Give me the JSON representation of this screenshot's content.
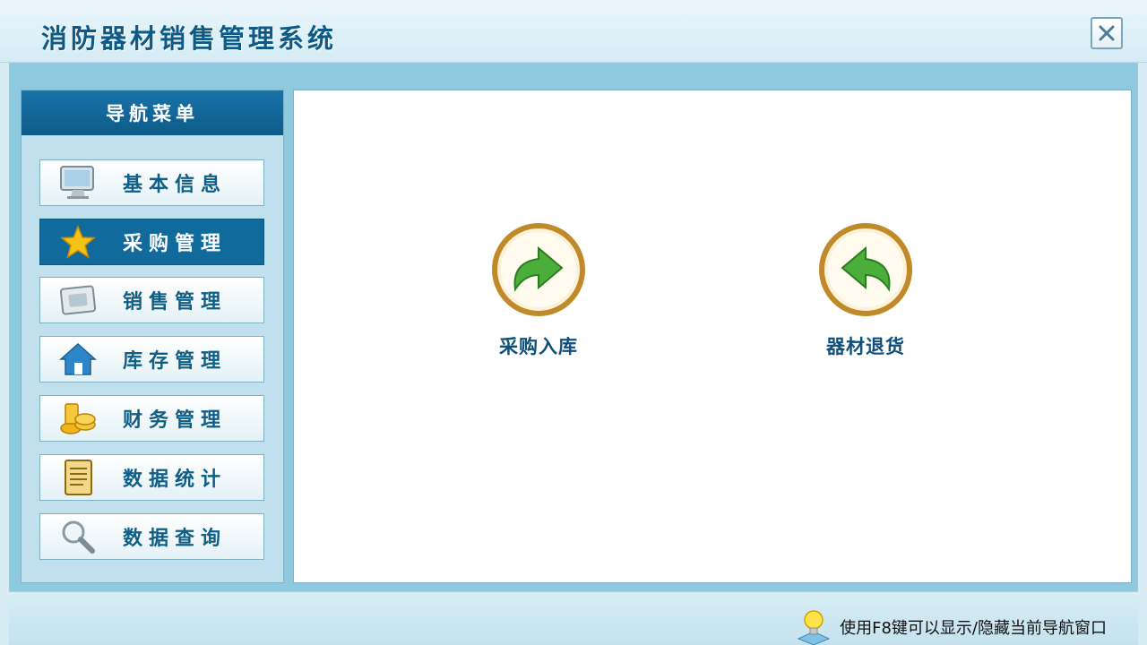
{
  "window": {
    "title": "消防器材销售管理系统",
    "close_label": "✕"
  },
  "sidebar": {
    "header": "导航菜单",
    "items": [
      {
        "label": "基本信息",
        "icon": "monitor-icon",
        "active": false
      },
      {
        "label": "采购管理",
        "icon": "star-icon",
        "active": true
      },
      {
        "label": "销售管理",
        "icon": "card-icon",
        "active": false
      },
      {
        "label": "库存管理",
        "icon": "home-icon",
        "active": false
      },
      {
        "label": "财务管理",
        "icon": "coins-icon",
        "active": false
      },
      {
        "label": "数据统计",
        "icon": "document-icon",
        "active": false
      },
      {
        "label": "数据查询",
        "icon": "magnifier-icon",
        "active": false
      }
    ]
  },
  "main": {
    "actions": [
      {
        "label": "采购入库",
        "icon": "arrow-forward-icon"
      },
      {
        "label": "器材退货",
        "icon": "arrow-back-icon"
      }
    ]
  },
  "statusbar": {
    "hint": "使用F8键可以显示/隐藏当前导航窗口",
    "icon": "lightbulb-icon"
  },
  "colors": {
    "accent": "#116a9c",
    "title_text": "#0e5a86",
    "frame": "#8fc9df",
    "sidebar_bg": "#bfe0ec"
  }
}
